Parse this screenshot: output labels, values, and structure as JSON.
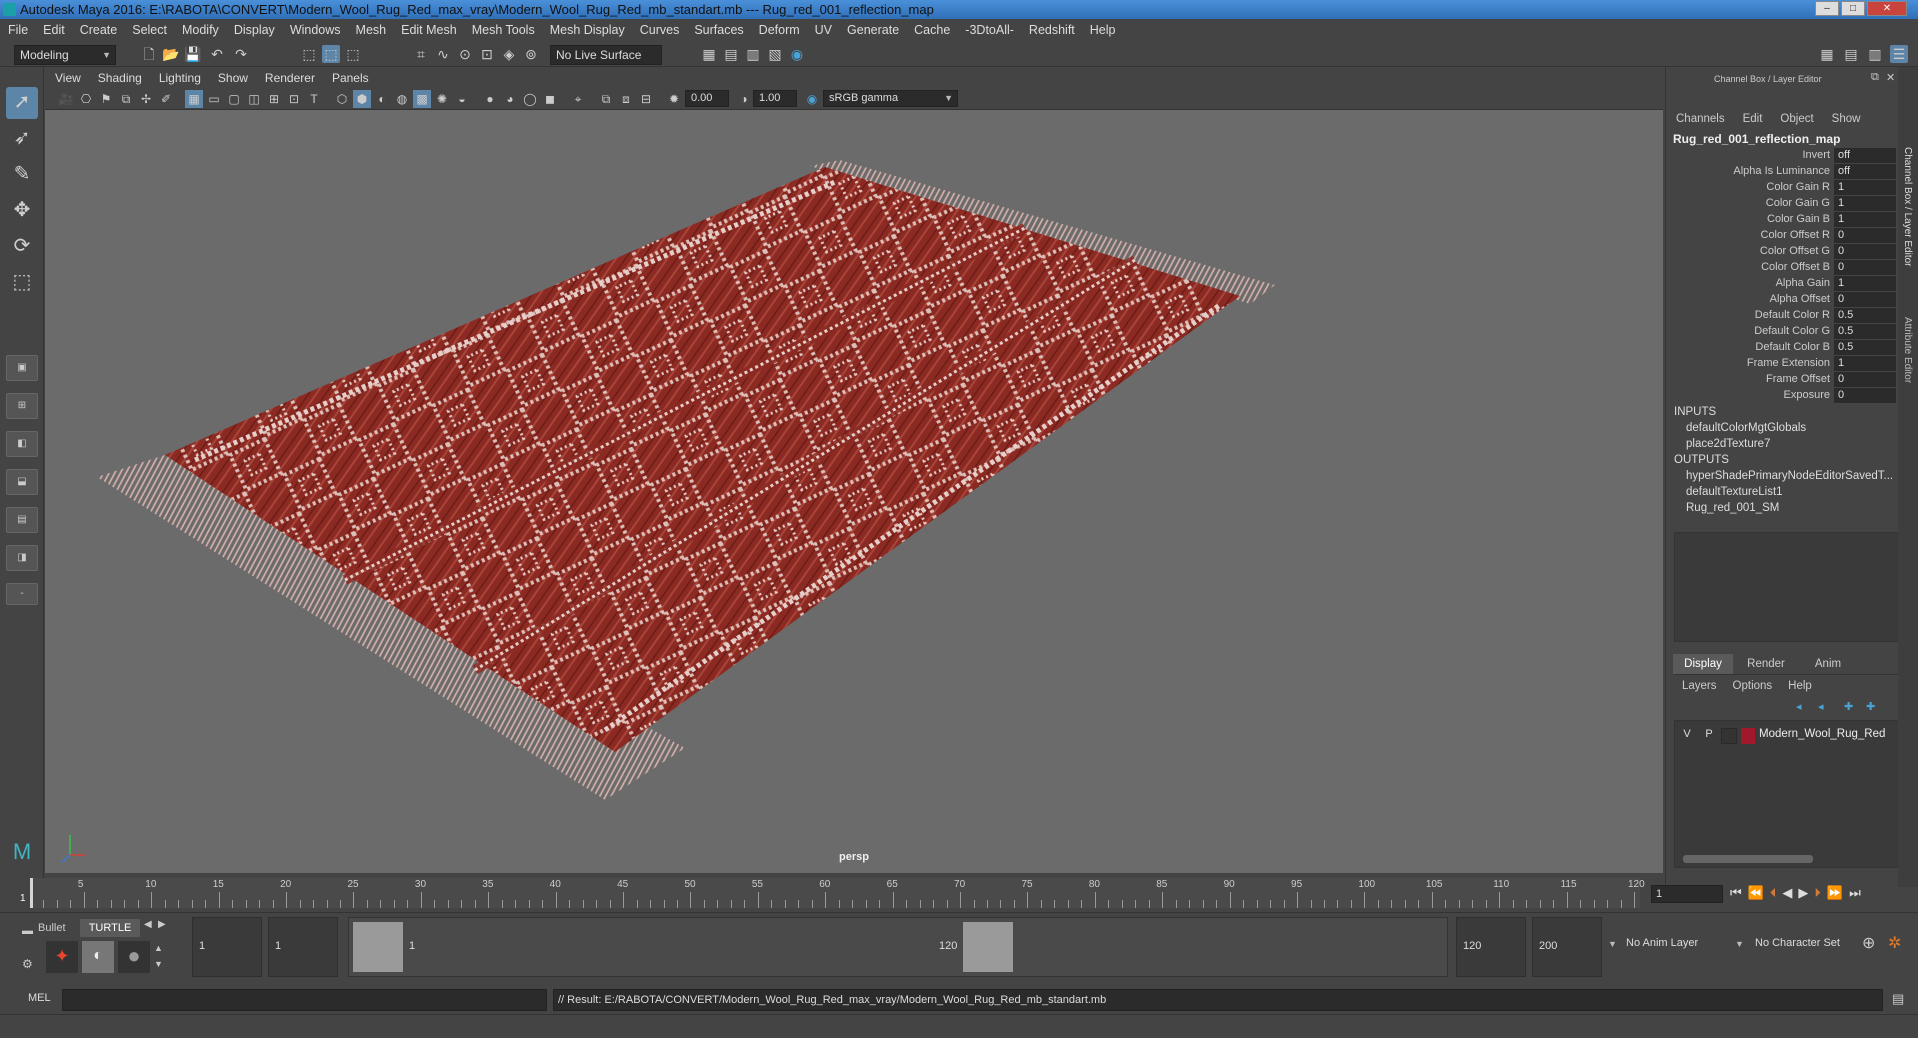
{
  "window": {
    "title": "Autodesk Maya 2016: E:\\RABOTA\\CONVERT\\Modern_Wool_Rug_Red_max_vray\\Modern_Wool_Rug_Red_mb_standart.mb   ---   Rug_red_001_reflection_map",
    "minimize": "–",
    "maximize": "□",
    "close": "✕"
  },
  "menubar": [
    "File",
    "Edit",
    "Create",
    "Select",
    "Modify",
    "Display",
    "Windows",
    "Mesh",
    "Edit Mesh",
    "Mesh Tools",
    "Mesh Display",
    "Curves",
    "Surfaces",
    "Deform",
    "UV",
    "Generate",
    "Cache",
    "-3DtoAll-",
    "Redshift",
    "Help"
  ],
  "statusline": {
    "mode": "Modeling",
    "live_surface": "No Live Surface"
  },
  "viewport": {
    "menu": [
      "View",
      "Shading",
      "Lighting",
      "Show",
      "Renderer",
      "Panels"
    ],
    "exposure": "0.00",
    "gamma": "1.00",
    "colorspace": "sRGB gamma",
    "camera_label": "persp"
  },
  "channel_box": {
    "header": "Channel Box / Layer Editor",
    "menu": [
      "Channels",
      "Edit",
      "Object",
      "Show"
    ],
    "node_name": "Rug_red_001_reflection_map",
    "attributes": [
      {
        "label": "Invert",
        "value": "off"
      },
      {
        "label": "Alpha Is Luminance",
        "value": "off"
      },
      {
        "label": "Color Gain R",
        "value": "1"
      },
      {
        "label": "Color Gain G",
        "value": "1"
      },
      {
        "label": "Color Gain B",
        "value": "1"
      },
      {
        "label": "Color Offset R",
        "value": "0"
      },
      {
        "label": "Color Offset G",
        "value": "0"
      },
      {
        "label": "Color Offset B",
        "value": "0"
      },
      {
        "label": "Alpha Gain",
        "value": "1"
      },
      {
        "label": "Alpha Offset",
        "value": "0"
      },
      {
        "label": "Default Color R",
        "value": "0.5"
      },
      {
        "label": "Default Color G",
        "value": "0.5"
      },
      {
        "label": "Default Color B",
        "value": "0.5"
      },
      {
        "label": "Frame Extension",
        "value": "1"
      },
      {
        "label": "Frame Offset",
        "value": "0"
      },
      {
        "label": "Exposure",
        "value": "0"
      }
    ],
    "inputs_label": "INPUTS",
    "inputs": [
      "defaultColorMgtGlobals",
      "place2dTexture7"
    ],
    "outputs_label": "OUTPUTS",
    "outputs": [
      "hyperShadePrimaryNodeEditorSavedT...",
      "defaultTextureList1",
      "Rug_red_001_SM"
    ]
  },
  "side_tabs": [
    "Channel Box / Layer Editor",
    "Attribute Editor"
  ],
  "layer_editor": {
    "tabs": [
      "Display",
      "Render",
      "Anim"
    ],
    "menu": [
      "Layers",
      "Options",
      "Help"
    ],
    "layer": {
      "v": "V",
      "p": "P",
      "name": "Modern_Wool_Rug_Red",
      "color": "#a3172a"
    }
  },
  "timeline": {
    "ticks": [
      "5",
      "10",
      "15",
      "20",
      "25",
      "30",
      "35",
      "40",
      "45",
      "50",
      "55",
      "60",
      "65",
      "70",
      "75",
      "80",
      "85",
      "90",
      "95",
      "100",
      "105",
      "110",
      "115",
      "120"
    ],
    "current_frame_marker": "1",
    "current_frame": "1"
  },
  "range": {
    "shelf_tabs": [
      "Bullet",
      "TURTLE"
    ],
    "start": "1",
    "playback_start": "1",
    "slider_start": "1",
    "slider_end": "120",
    "playback_end": "120",
    "end": "200",
    "anim_layer": "No Anim Layer",
    "character_set": "No Character Set"
  },
  "command": {
    "lang": "MEL",
    "result": "// Result: E:/RABOTA/CONVERT/Modern_Wool_Rug_Red_max_vray/Modern_Wool_Rug_Red_mb_standart.mb"
  }
}
